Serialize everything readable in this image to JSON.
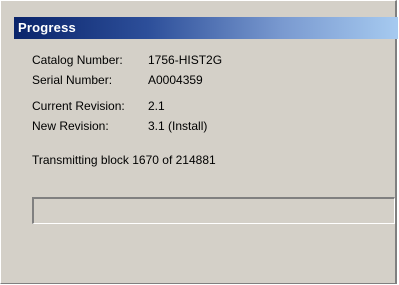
{
  "window": {
    "title": "Progress"
  },
  "info": {
    "catalog_label": "Catalog Number:",
    "catalog_value": "1756-HIST2G",
    "serial_label": "Serial Number:",
    "serial_value": "A0004359",
    "current_rev_label": "Current Revision:",
    "current_rev_value": "2.1",
    "new_rev_label": "New Revision:",
    "new_rev_value": "3.1 (Install)"
  },
  "status": {
    "text": "Transmitting block 1670 of 214881"
  },
  "progress": {
    "fraction": 0.0
  },
  "colors": {
    "dialog_bg": "#d4d0c8",
    "titlebar_start": "#0a246a",
    "titlebar_end": "#a6caf0",
    "title_text": "#ffffff"
  }
}
